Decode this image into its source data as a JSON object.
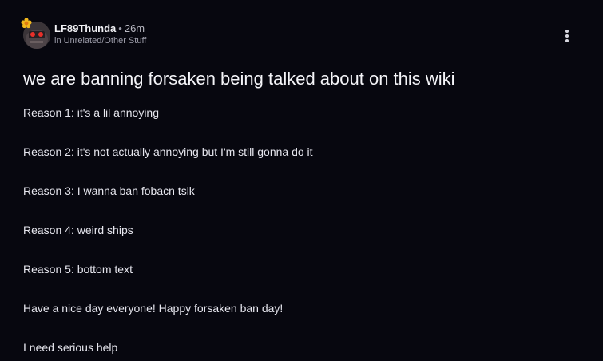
{
  "post": {
    "author": "LF89Thunda",
    "separator": "•",
    "time": "26m",
    "category": "in Unrelated/Other Stuff",
    "title": "we are banning forsaken being talked about on this wiki",
    "paragraphs": [
      "Reason 1: it's a lil annoying",
      "Reason 2: it's not actually annoying but I'm still gonna do it",
      "Reason 3: I wanna ban fobacn tslk",
      "Reason 4: weird ships",
      "Reason 5: bottom text",
      "Have a nice day everyone! Happy forsaken ban day!",
      "I need serious help"
    ]
  },
  "icons": {
    "avatar": "user-avatar",
    "badge": "flower-badge-icon",
    "menu": "more-options-icon"
  },
  "colors": {
    "background": "#07070f",
    "text": "#ececf2",
    "muted": "#9d9daa",
    "badge": "#f2b81c"
  }
}
